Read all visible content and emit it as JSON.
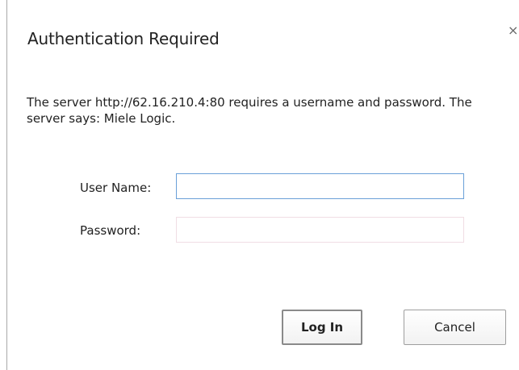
{
  "dialog": {
    "title": "Authentication Required",
    "close_glyph": "×",
    "message": "The server http://62.16.210.4:80 requires a username and password. The server says: Miele Logic."
  },
  "form": {
    "username_label": "User Name:",
    "username_value": "",
    "password_label": "Password:",
    "password_value": ""
  },
  "buttons": {
    "login_label": "Log In",
    "cancel_label": "Cancel"
  },
  "colors": {
    "focused_input_border": "#6aa0d8",
    "text": "#222222"
  }
}
